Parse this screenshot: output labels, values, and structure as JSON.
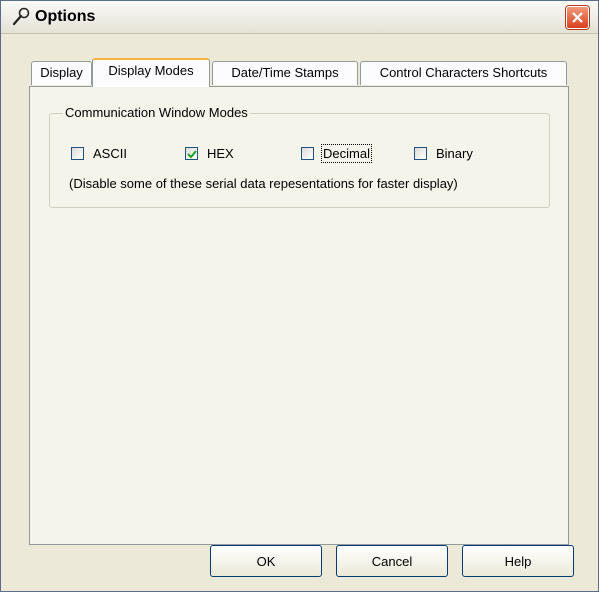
{
  "window": {
    "title": "Options",
    "title_icon": "wrench-icon",
    "close_icon": "close-icon"
  },
  "tabs": [
    {
      "label": "Display",
      "active": false
    },
    {
      "label": "Display Modes",
      "active": true
    },
    {
      "label": "Date/Time Stamps",
      "active": false
    },
    {
      "label": "Control Characters Shortcuts",
      "active": false
    }
  ],
  "group": {
    "title": "Communication Window Modes",
    "options": [
      {
        "label": "ASCII",
        "checked": false
      },
      {
        "label": "HEX",
        "checked": true
      },
      {
        "label": "Decimal",
        "checked": false,
        "focused": true
      },
      {
        "label": "Binary",
        "checked": false
      }
    ],
    "note": "(Disable some of these serial data repesentations for faster display)"
  },
  "buttons": {
    "ok": "OK",
    "cancel": "Cancel",
    "help": "Help"
  },
  "colors": {
    "tab_highlight": "#f9b23c",
    "close_button": "#d9401d",
    "dialog_bg": "#ece9d8"
  }
}
